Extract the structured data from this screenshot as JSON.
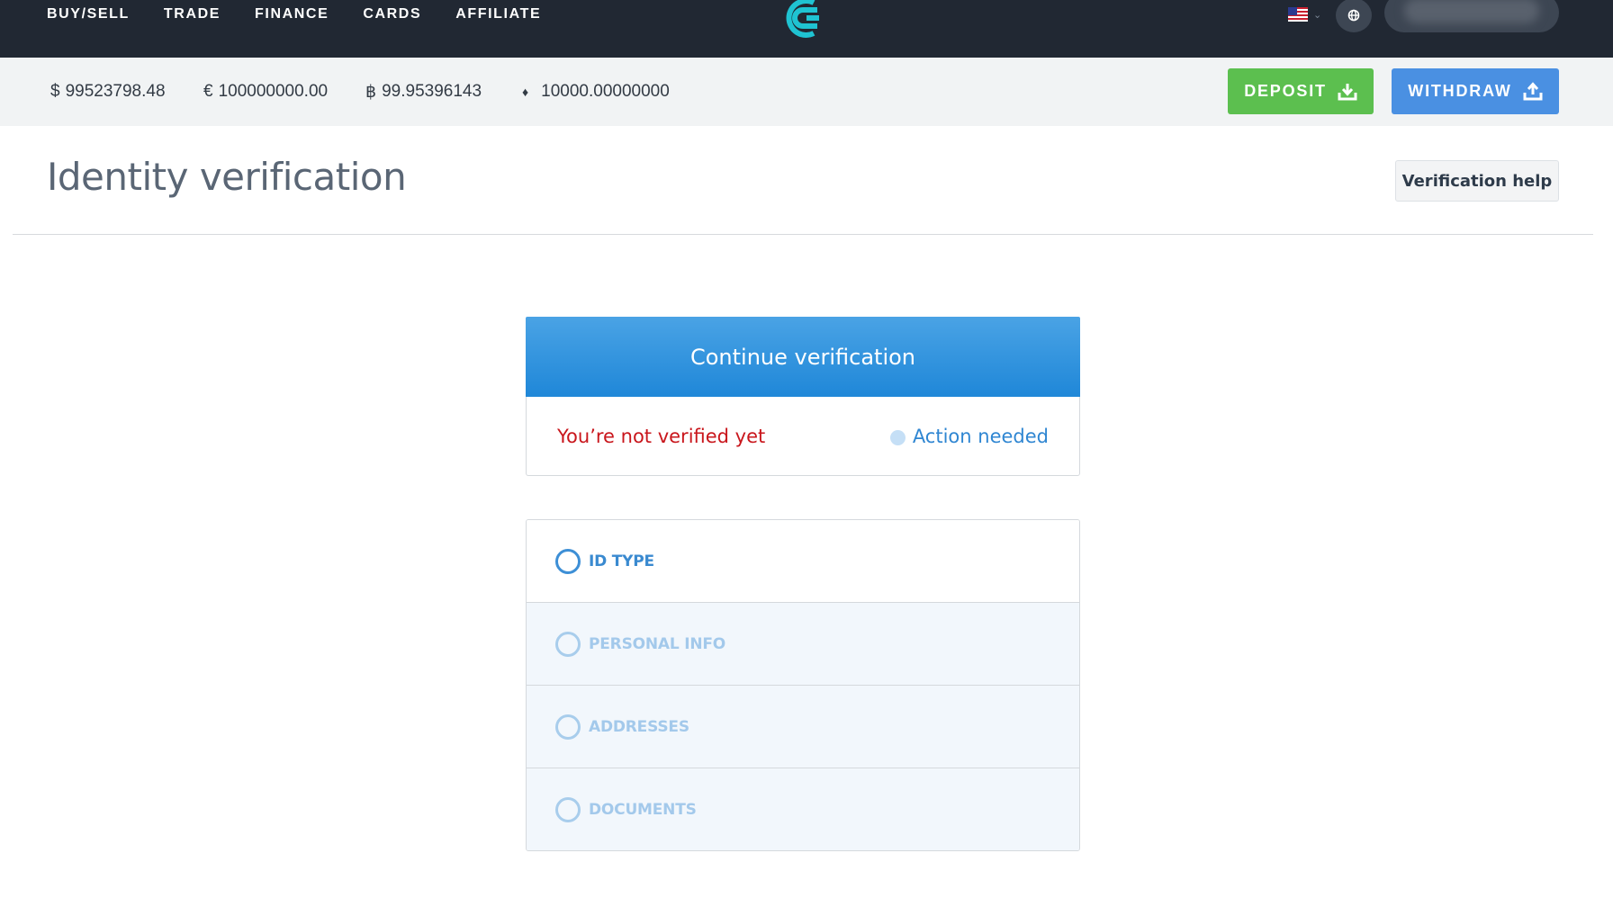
{
  "nav": {
    "links": [
      "BUY/SELL",
      "TRADE",
      "FINANCE",
      "CARDS",
      "AFFILIATE"
    ],
    "account_name": ""
  },
  "balances": [
    {
      "symbol": "$",
      "amount": "99523798.48"
    },
    {
      "symbol": "€",
      "amount": "100000000.00"
    },
    {
      "symbol": "฿",
      "amount": "99.95396143"
    },
    {
      "symbol": "♦",
      "amount": "10000.00000000"
    }
  ],
  "actions": {
    "deposit_label": "DEPOSIT",
    "withdraw_label": "WITHDRAW"
  },
  "page": {
    "title": "Identity verification",
    "help_label": "Verification help"
  },
  "verification": {
    "header": "Continue verification",
    "status_text": "You’re not verified yet",
    "action_text": "Action needed"
  },
  "steps": [
    "ID TYPE",
    "PERSONAL INFO",
    "ADDRESSES",
    "DOCUMENTS"
  ],
  "colors": {
    "nav_bg": "#212833",
    "deposit": "#5cbf4f",
    "withdraw": "#4a90e2",
    "status_error": "#c9161c",
    "action_blue": "#2f86d2",
    "logo_teal": "#1fc3d2"
  },
  "icons": {
    "logo": "cex-logo-icon",
    "flag": "us-flag-icon",
    "globe": "globe-icon",
    "deposit": "download-icon",
    "withdraw": "upload-icon"
  }
}
